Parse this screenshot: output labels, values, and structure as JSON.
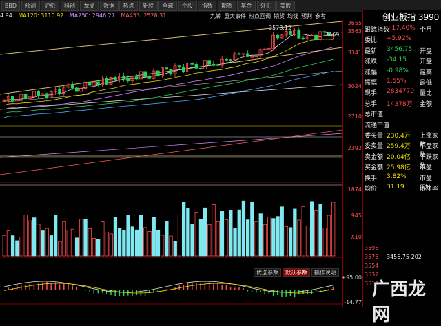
{
  "toolbar": {
    "buttons": [
      "BBD",
      "预测",
      "沪伦",
      "科创",
      "龙虎",
      "数据",
      "热点",
      "新股",
      "全球",
      "个股",
      "指数",
      "期货",
      "基金",
      "外汇",
      "美股"
    ],
    "right_tabs": [
      "九转",
      "重大事件",
      "热点回调",
      "期货",
      "均线",
      "预判",
      "参考"
    ]
  },
  "ma_legend": {
    "ma5": "4.94",
    "ma120": "MA120: 3110.92",
    "ma250": "MA250: 2946.27",
    "ma453": "MA453: 2528.31"
  },
  "price_annotations": {
    "high": "3578.12",
    "last": "3469.1"
  },
  "axis": {
    "labels": [
      "3655",
      "3563",
      "3341",
      "3024",
      "2710",
      "2392",
      "1874",
      "945",
      "X10",
      "+95.00",
      "-14.77"
    ]
  },
  "info": {
    "title": "创业板指 3990",
    "rows": [
      {
        "label": "跟踪指数",
        "value": "+17.40%",
        "extra": "个月"
      },
      {
        "label": "委比",
        "value": "+5.92%",
        "extra": ""
      },
      {
        "label": "最新",
        "value": "3456.75",
        "extra": "开盘"
      },
      {
        "label": "涨跌",
        "value": "-34.15",
        "extra": "开盘"
      },
      {
        "label": "涨幅",
        "value": "-0.98%",
        "extra": "最高"
      },
      {
        "label": "振幅",
        "value": "1.55%",
        "extra": "最低"
      },
      {
        "label": "现手",
        "value": "2834770",
        "extra": "量比"
      },
      {
        "label": "总手",
        "value": "14378万",
        "extra": "金额"
      },
      {
        "label": "总市值",
        "value": "",
        "extra": ""
      },
      {
        "label": "流通市值",
        "value": "",
        "extra": ""
      },
      {
        "label": "委买量",
        "value": "230.4万",
        "extra": "上涨家数"
      },
      {
        "label": "委卖量",
        "value": "259.4万",
        "extra": "平盘家数"
      },
      {
        "label": "卖金额",
        "value": "20.04亿",
        "extra": "下跌家数"
      },
      {
        "label": "买金额",
        "value": "25.98亿",
        "extra": "市盈"
      },
      {
        "label": "换手",
        "value": "3.82%",
        "extra": "市盈(动)"
      },
      {
        "label": "均价",
        "value": "31.19",
        "extra": "市净率"
      }
    ],
    "mini_table": [
      {
        "p": "3596",
        "v": ""
      },
      {
        "p": "3576",
        "v": "3456.75  202"
      },
      {
        "p": "3554",
        "v": ""
      },
      {
        "p": "3532",
        "v": ""
      },
      {
        "p": "3510",
        "v": ""
      }
    ]
  },
  "indicator_tabs": [
    "优选参数",
    "默认参数",
    "操作说明"
  ],
  "watermark": "广西龙网",
  "colors": {
    "up": "#ff4d4d",
    "down": "#29d25a",
    "volume": "#7fe8f0",
    "panel_border": "#8b0000"
  }
}
